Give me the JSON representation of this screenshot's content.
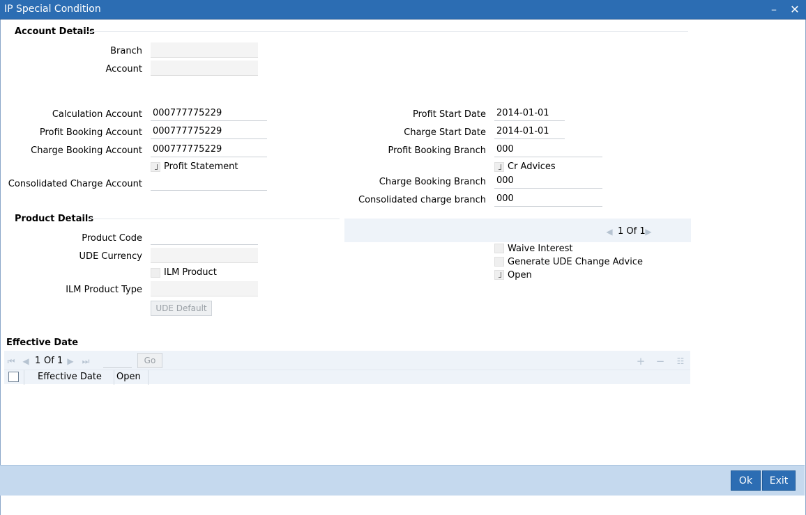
{
  "window": {
    "title": "IP Special Condition",
    "minimize_glyph": "–",
    "close_glyph": "✕"
  },
  "account_details": {
    "title": "Account Details",
    "branch_label": "Branch",
    "branch_value": "",
    "account_label": "Account",
    "account_value": ""
  },
  "main": {
    "calculation_account_label": "Calculation Account",
    "calculation_account_value": "000777775229",
    "profit_booking_account_label": "Profit Booking Account",
    "profit_booking_account_value": "000777775229",
    "charge_booking_account_label": "Charge Booking Account",
    "charge_booking_account_value": "000777775229",
    "profit_statement_label": "Profit Statement",
    "profit_statement_checked": true,
    "consolidated_charge_account_label": "Consolidated Charge Account",
    "consolidated_charge_account_value": "",
    "profit_start_date_label": "Profit Start Date",
    "profit_start_date_value": "2014-01-01",
    "charge_start_date_label": "Charge Start Date",
    "charge_start_date_value": "2014-01-01",
    "profit_booking_branch_label": "Profit Booking Branch",
    "profit_booking_branch_value": "000",
    "cr_advices_label": "Cr Advices",
    "cr_advices_checked": true,
    "charge_booking_branch_label": "Charge Booking Branch",
    "charge_booking_branch_value": "000",
    "consolidated_charge_branch_label": "Consolidated charge branch",
    "consolidated_charge_branch_value": "000"
  },
  "product_details": {
    "title": "Product Details",
    "product_code_label": "Product Code",
    "product_code_value": "",
    "ude_currency_label": "UDE Currency",
    "ude_currency_value": "",
    "ilm_product_label": "ILM Product",
    "ilm_product_checked": false,
    "ilm_product_type_label": "ILM Product Type",
    "ilm_product_type_value": "",
    "ude_default_label": "UDE Default",
    "pager_text": "1 Of 1",
    "waive_interest_label": "Waive Interest",
    "waive_interest_checked": false,
    "generate_ude_label": "Generate UDE Change Advice",
    "generate_ude_checked": false,
    "open_label": "Open",
    "open_checked": true
  },
  "effective_date": {
    "title": "Effective Date",
    "pager_current": "1",
    "pager_of": "Of",
    "pager_total": "1",
    "go_label": "Go",
    "columns": [
      "Effective Date",
      "Open"
    ]
  },
  "footer": {
    "ok_label": "Ok",
    "exit_label": "Exit"
  },
  "icons": {
    "first": "first-page-icon",
    "prev": "prev-page-icon",
    "next": "next-page-icon",
    "last": "last-page-icon",
    "add": "add-row-icon",
    "remove": "remove-row-icon",
    "view": "single-view-icon"
  },
  "colors": {
    "title_bar": "#2c6db3",
    "footer_bar": "#c5d9ee",
    "band": "#eef3f9"
  }
}
